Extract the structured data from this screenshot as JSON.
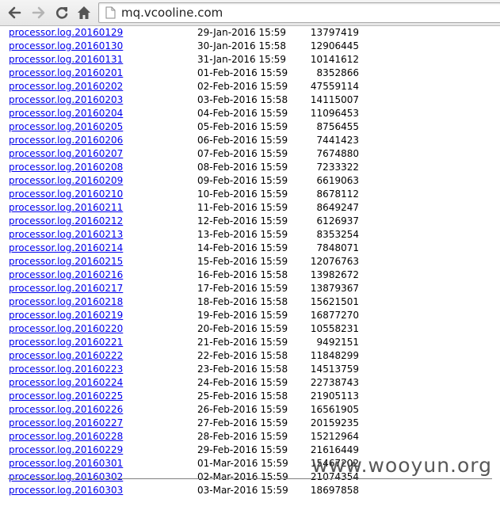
{
  "browser": {
    "url": "mq.vcooline.com"
  },
  "icons": {
    "back": "back-arrow-icon",
    "forward": "forward-arrow-icon",
    "reload": "reload-icon",
    "home": "home-icon",
    "page": "page-icon"
  },
  "listing": {
    "rows": [
      {
        "name": "processor.log.20160129",
        "date": "29-Jan-2016 15:59",
        "size": "13797419"
      },
      {
        "name": "processor.log.20160130",
        "date": "30-Jan-2016 15:58",
        "size": "12906445"
      },
      {
        "name": "processor.log.20160131",
        "date": "31-Jan-2016 15:59",
        "size": "10141612"
      },
      {
        "name": "processor.log.20160201",
        "date": "01-Feb-2016 15:59",
        "size": "8352866"
      },
      {
        "name": "processor.log.20160202",
        "date": "02-Feb-2016 15:59",
        "size": "47559114"
      },
      {
        "name": "processor.log.20160203",
        "date": "03-Feb-2016 15:58",
        "size": "14115007"
      },
      {
        "name": "processor.log.20160204",
        "date": "04-Feb-2016 15:59",
        "size": "11096453"
      },
      {
        "name": "processor.log.20160205",
        "date": "05-Feb-2016 15:59",
        "size": "8756455"
      },
      {
        "name": "processor.log.20160206",
        "date": "06-Feb-2016 15:59",
        "size": "7441423"
      },
      {
        "name": "processor.log.20160207",
        "date": "07-Feb-2016 15:59",
        "size": "7674880"
      },
      {
        "name": "processor.log.20160208",
        "date": "08-Feb-2016 15:59",
        "size": "7233322"
      },
      {
        "name": "processor.log.20160209",
        "date": "09-Feb-2016 15:59",
        "size": "6619063"
      },
      {
        "name": "processor.log.20160210",
        "date": "10-Feb-2016 15:59",
        "size": "8678112"
      },
      {
        "name": "processor.log.20160211",
        "date": "11-Feb-2016 15:59",
        "size": "8649247"
      },
      {
        "name": "processor.log.20160212",
        "date": "12-Feb-2016 15:59",
        "size": "6126937"
      },
      {
        "name": "processor.log.20160213",
        "date": "13-Feb-2016 15:59",
        "size": "8353254"
      },
      {
        "name": "processor.log.20160214",
        "date": "14-Feb-2016 15:59",
        "size": "7848071"
      },
      {
        "name": "processor.log.20160215",
        "date": "15-Feb-2016 15:59",
        "size": "12076763"
      },
      {
        "name": "processor.log.20160216",
        "date": "16-Feb-2016 15:58",
        "size": "13982672"
      },
      {
        "name": "processor.log.20160217",
        "date": "17-Feb-2016 15:59",
        "size": "13879367"
      },
      {
        "name": "processor.log.20160218",
        "date": "18-Feb-2016 15:58",
        "size": "15621501"
      },
      {
        "name": "processor.log.20160219",
        "date": "19-Feb-2016 15:59",
        "size": "16877270"
      },
      {
        "name": "processor.log.20160220",
        "date": "20-Feb-2016 15:59",
        "size": "10558231"
      },
      {
        "name": "processor.log.20160221",
        "date": "21-Feb-2016 15:59",
        "size": "9492151"
      },
      {
        "name": "processor.log.20160222",
        "date": "22-Feb-2016 15:58",
        "size": "11848299"
      },
      {
        "name": "processor.log.20160223",
        "date": "23-Feb-2016 15:58",
        "size": "14513759"
      },
      {
        "name": "processor.log.20160224",
        "date": "24-Feb-2016 15:59",
        "size": "22738743"
      },
      {
        "name": "processor.log.20160225",
        "date": "25-Feb-2016 15:58",
        "size": "21905113"
      },
      {
        "name": "processor.log.20160226",
        "date": "26-Feb-2016 15:59",
        "size": "16561905"
      },
      {
        "name": "processor.log.20160227",
        "date": "27-Feb-2016 15:59",
        "size": "20159235"
      },
      {
        "name": "processor.log.20160228",
        "date": "28-Feb-2016 15:59",
        "size": "15212964"
      },
      {
        "name": "processor.log.20160229",
        "date": "29-Feb-2016 15:59",
        "size": "21616449"
      },
      {
        "name": "processor.log.20160301",
        "date": "01-Mar-2016 15:59",
        "size": "15467202"
      },
      {
        "name": "processor.log.20160302",
        "date": "02-Mar-2016 15:59",
        "size": "21074354"
      },
      {
        "name": "processor.log.20160303",
        "date": "03-Mar-2016 15:59",
        "size": "18697858"
      }
    ]
  },
  "watermark": {
    "text": "www.wooyun.org"
  }
}
